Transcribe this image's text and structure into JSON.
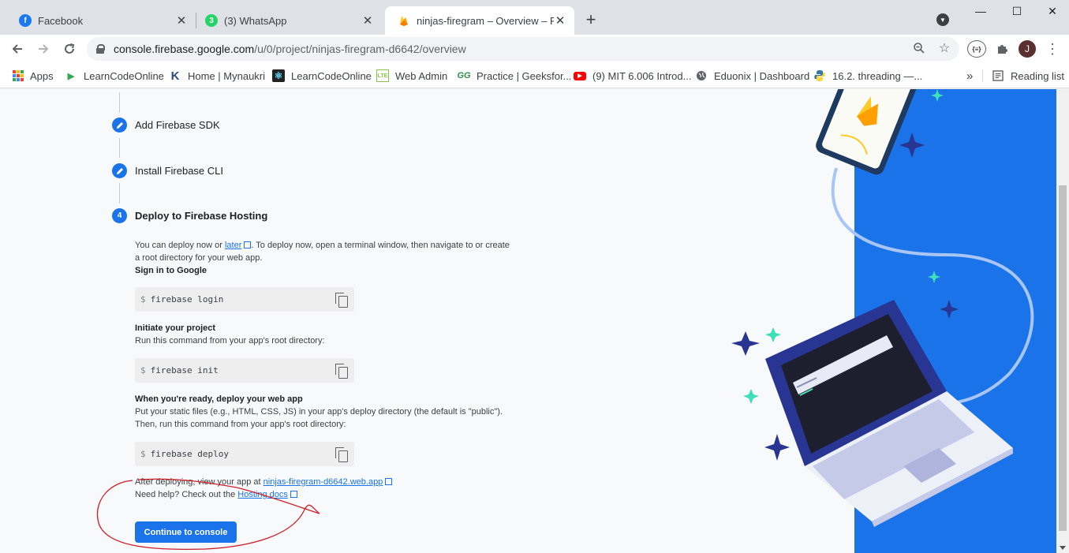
{
  "tabs": [
    {
      "title": "Facebook",
      "icon": "facebook-icon"
    },
    {
      "title": "(3) WhatsApp",
      "icon": "whatsapp-icon",
      "badge": "3"
    },
    {
      "title": "ninjas-firegram – Overview – Fire",
      "icon": "firebase-icon",
      "active": true
    }
  ],
  "toolbar": {
    "url_host": "console.firebase.google.com",
    "url_path": "/u/0/project/ninjas-firegram-d6642/overview",
    "extension_badge": "{≡}",
    "avatar_initial": "J"
  },
  "bookmarks": [
    {
      "label": "Apps",
      "icon": "apps-grid-icon"
    },
    {
      "label": "LearnCodeOnline",
      "icon": "play-icon"
    },
    {
      "label": "Home | Mynaukri",
      "icon": "k-logo-icon"
    },
    {
      "label": "LearnCodeOnline",
      "icon": "react-icon"
    },
    {
      "label": "Web Admin",
      "icon": "lte-icon"
    },
    {
      "label": "Practice | Geeksfor...",
      "icon": "gfg-icon"
    },
    {
      "label": "(9) MIT 6.006 Introd...",
      "icon": "youtube-icon"
    },
    {
      "label": "Eduonix | Dashboard",
      "icon": "globe-icon"
    },
    {
      "label": "16.2. threading —...",
      "icon": "python-icon"
    }
  ],
  "bookmarks_overflow": "»",
  "reading_list": "Reading list",
  "steps": [
    {
      "title": "Add Firebase SDK",
      "icon": "pencil-icon"
    },
    {
      "title": "Install Firebase CLI",
      "icon": "pencil-icon"
    },
    {
      "title": "Deploy to Firebase Hosting",
      "number": "4"
    }
  ],
  "deploy": {
    "intro_pre": "You can deploy now or ",
    "intro_link": "later",
    "intro_post": ". To deploy now, open a terminal window, then navigate to or create a root directory for your web app.",
    "signin_heading": "Sign in to Google",
    "cmd_login_prompt": "$",
    "cmd_login": "firebase login",
    "init_heading": "Initiate your project",
    "init_text": "Run this command from your app's root directory:",
    "cmd_init_prompt": "$",
    "cmd_init": "firebase init",
    "ready_heading": "When you're ready, deploy your web app",
    "ready_text1": "Put your static files (e.g., HTML, CSS, JS) in your app's deploy directory (the default is \"public\").",
    "ready_text2": "Then, run this command from your app's root directory:",
    "cmd_deploy_prompt": "$",
    "cmd_deploy": "firebase deploy",
    "after_pre": "After deploying, view your app at ",
    "after_link": "ninjas-firegram-d6642.web.app",
    "help_pre": "Need help? Check out the ",
    "help_link": "Hosting docs",
    "continue_label": "Continue to console"
  },
  "colors": {
    "accent": "#1a73e8",
    "illustration_blue": "#1a73e8",
    "annotation_red": "#cc1f2a"
  }
}
